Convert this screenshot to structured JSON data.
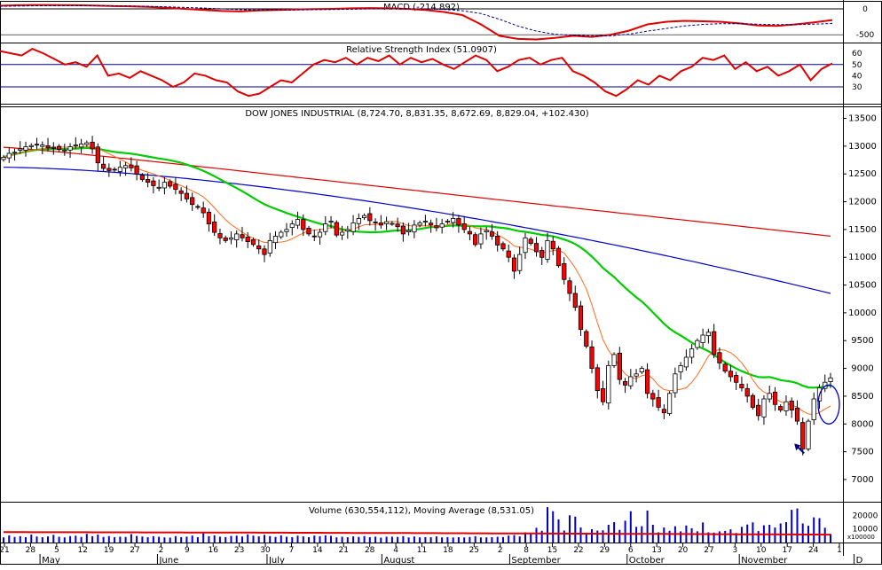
{
  "colors": {
    "red": "#e00000",
    "green": "#00cc00",
    "navy": "#000080",
    "blue": "#0000cc",
    "bull_fill": "#ffffff",
    "bear_fill": "#ff0000",
    "black": "#000000",
    "grid": "#000000",
    "panel_bg": "#ffffff"
  },
  "panels": {
    "macd": {
      "label": "MACD (-214.892)"
    },
    "rsi": {
      "label": "Relative Strength Index (51.0907)"
    },
    "price": {
      "label": "DOW JONES INDUSTRIAL (8,724.70, 8,831.35, 8,672.69, 8,829.04, +102.430)"
    },
    "volume": {
      "label": "Volume (630,554,112), Moving Average (8,531.05)",
      "multiplier": "x100000"
    }
  },
  "chart_data": [
    {
      "type": "line",
      "panel": "macd",
      "title": "MACD (-214.892)",
      "ylim": [
        -650,
        120
      ],
      "y_ticks": [
        "0",
        "-500"
      ],
      "series": [
        {
          "name": "MACD",
          "color": "#e00000",
          "style": "solid",
          "values": [
            60,
            70,
            75,
            72,
            70,
            65,
            55,
            50,
            40,
            20,
            0,
            -20,
            -40,
            -50,
            -30,
            -20,
            -10,
            -5,
            0,
            10,
            15,
            10,
            0,
            -20,
            -60,
            -120,
            -300,
            -520,
            -580,
            -590,
            -560,
            -520,
            -540,
            -500,
            -420,
            -300,
            -250,
            -230,
            -240,
            -250,
            -280,
            -320,
            -330,
            -300,
            -260,
            -215
          ]
        },
        {
          "name": "Signal",
          "color": "#000080",
          "style": "dashed",
          "values": [
            50,
            55,
            60,
            62,
            63,
            62,
            60,
            55,
            50,
            40,
            28,
            15,
            0,
            -15,
            -22,
            -22,
            -20,
            -16,
            -12,
            -6,
            0,
            4,
            4,
            0,
            -10,
            -35,
            -90,
            -200,
            -330,
            -430,
            -490,
            -510,
            -520,
            -520,
            -490,
            -430,
            -380,
            -330,
            -300,
            -285,
            -285,
            -295,
            -305,
            -305,
            -295,
            -280
          ]
        }
      ]
    },
    {
      "type": "line",
      "panel": "rsi",
      "title": "Relative Strength Index (51.0907)",
      "ylim": [
        15,
        68
      ],
      "y_ticks": [
        "60",
        "50",
        "40",
        "30"
      ],
      "reference_lines": [
        50,
        30
      ],
      "series": [
        {
          "name": "RSI",
          "color": "#e00000",
          "values": [
            62,
            60,
            58,
            64,
            60,
            55,
            50,
            52,
            48,
            58,
            40,
            42,
            38,
            44,
            40,
            36,
            30,
            34,
            42,
            40,
            36,
            34,
            26,
            22,
            24,
            30,
            36,
            34,
            42,
            50,
            54,
            52,
            56,
            50,
            56,
            53,
            58,
            50,
            56,
            52,
            55,
            50,
            46,
            52,
            58,
            54,
            44,
            48,
            54,
            56,
            50,
            54,
            56,
            44,
            40,
            34,
            26,
            22,
            28,
            36,
            32,
            40,
            36,
            44,
            48,
            56,
            54,
            58,
            46,
            52,
            44,
            48,
            40,
            44,
            50,
            36,
            46,
            51
          ]
        }
      ]
    },
    {
      "type": "candlestick",
      "panel": "price",
      "title": "DOW JONES INDUSTRIAL (8,724.70, 8,831.35, 8,672.69, 8,829.04, +102.430)",
      "ylim": [
        6600,
        13700
      ],
      "y_ticks": [
        13500,
        13000,
        12500,
        12000,
        11500,
        11000,
        10500,
        10000,
        9500,
        9000,
        8500,
        8000,
        7500,
        7000
      ],
      "x_ticks": [
        "21",
        "28",
        "5",
        "12",
        "19",
        "27",
        "2",
        "9",
        "16",
        "23",
        "30",
        "7",
        "14",
        "21",
        "28",
        "4",
        "11",
        "18",
        "25",
        "2",
        "8",
        "15",
        "22",
        "29",
        "6",
        "13",
        "20",
        "27",
        "3",
        "10",
        "17",
        "24",
        "1"
      ],
      "month_labels": [
        "May",
        "June",
        "July",
        "August",
        "September",
        "October",
        "November",
        "D"
      ],
      "close": [
        12800,
        12870,
        12890,
        12950,
        12990,
        13010,
        13030,
        13020,
        12970,
        12960,
        12940,
        12930,
        12990,
        13020,
        13040,
        13060,
        12950,
        12700,
        12600,
        12560,
        12580,
        12620,
        12650,
        12610,
        12500,
        12400,
        12350,
        12290,
        12260,
        12350,
        12280,
        12220,
        12150,
        12050,
        11950,
        11900,
        11800,
        11600,
        11450,
        11350,
        11300,
        11350,
        11420,
        11350,
        11280,
        11230,
        11150,
        11050,
        11300,
        11380,
        11450,
        11500,
        11600,
        11680,
        11500,
        11420,
        11380,
        11450,
        11600,
        11650,
        11400,
        11450,
        11500,
        11620,
        11700,
        11750,
        11660,
        11620,
        11580,
        11640,
        11610,
        11550,
        11420,
        11480,
        11580,
        11620,
        11650,
        11580,
        11530,
        11600,
        11650,
        11700,
        11580,
        11500,
        11420,
        11230,
        11420,
        11480,
        11380,
        11220,
        11150,
        11000,
        10750,
        11050,
        11350,
        11250,
        11100,
        11000,
        11300,
        11150,
        10850,
        10600,
        10350,
        10100,
        9700,
        9400,
        9000,
        8600,
        8400,
        9050,
        9250,
        8800,
        8700,
        8850,
        8900,
        9000,
        8550,
        8450,
        8300,
        8200,
        8550,
        8900,
        9050,
        9200,
        9350,
        9500,
        9600,
        9650,
        9250,
        9100,
        8950,
        8850,
        8750,
        8650,
        8500,
        8300,
        8150,
        8450,
        8550,
        8350,
        8250,
        8400,
        8250,
        8050,
        7550,
        8050,
        8450,
        8650,
        8750,
        8829
      ]
    },
    {
      "type": "bar",
      "panel": "volume",
      "title": "Volume (630,554,112), Moving Average (8,531.05)",
      "ylim": [
        0,
        28000
      ],
      "y_ticks": [
        "20000",
        "10000"
      ],
      "values": [
        3800,
        5200,
        4100,
        4600,
        4000,
        5800,
        4400,
        3900,
        4500,
        5600,
        4200,
        3800,
        4700,
        5000,
        4100,
        6400,
        4600,
        5800,
        4100,
        4700,
        3900,
        4300,
        4100,
        6200,
        4800,
        4400,
        3900,
        4600,
        4200,
        3800,
        3600,
        4700,
        4000,
        4300,
        5100,
        3900,
        6800,
        4600,
        5200,
        4300,
        4000,
        4800,
        5000,
        4400,
        6000,
        5000,
        4500,
        5600,
        4700,
        4100,
        5300,
        4200,
        3900,
        5000,
        4500,
        3900,
        5100,
        4600,
        5300,
        4900,
        3800,
        4200,
        3900,
        4500,
        4100,
        4700,
        3900,
        4300,
        3600,
        4200,
        4300,
        4100,
        4700,
        3700,
        4400,
        3800,
        4000,
        3900,
        4500,
        3800,
        4000,
        3700,
        3900,
        3700,
        4100,
        4600,
        3800,
        3800,
        3900,
        4200,
        4000,
        5100,
        5500,
        4500,
        7400,
        6300,
        10800,
        8600,
        26000,
        23000,
        17000,
        8800,
        20000,
        19000,
        11000,
        7200,
        9800,
        8700,
        9000,
        13000,
        15000,
        9300,
        16000,
        23000,
        11500,
        12000,
        23500,
        13000,
        7500,
        11000,
        8600,
        12000,
        8200,
        12500,
        10500,
        8300,
        14700,
        7500,
        7300,
        8200,
        8500,
        9700,
        7000,
        11500,
        13200,
        14800,
        8400,
        12600,
        13000,
        11000,
        14000,
        15000,
        24000,
        25000,
        14000,
        12300,
        18500,
        17900,
        10900,
        6305
      ]
    }
  ]
}
